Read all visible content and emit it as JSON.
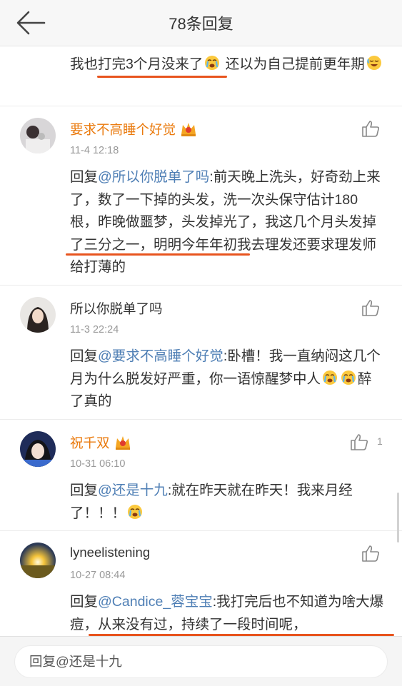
{
  "header": {
    "title": "78条回复"
  },
  "continuation": {
    "parts": [
      "我也",
      "打完3个月没来了",
      " 还以为自己提前更年期"
    ]
  },
  "comments": [
    {
      "name": "要求不高睡个好觉",
      "vip": true,
      "time": "11-4 12:18",
      "likes": "",
      "reply": {
        "prefix": "回复",
        "mention": "@所以你脱单了吗",
        "text_a": ":前天晚上洗头，好奇劲上来了，数了一下掉的头发，洗一次头保守估计180根，昨晚做噩梦，头发掉光了，我这",
        "highlight": "几个月头发掉了三分之一",
        "text_b": "，明明今年年初我去理发还要求理发师给打薄的"
      }
    },
    {
      "name": "所以你脱单了吗",
      "vip": false,
      "time": "11-3 22:24",
      "likes": "",
      "reply": {
        "prefix": "回复",
        "mention": "@要求不高睡个好觉",
        "text_a": ":卧槽！我一直纳闷这几个月为什么脱发好严重，你一语惊醒梦中人",
        "text_b": "醉了真的"
      }
    },
    {
      "name": "祝千双",
      "vip": true,
      "time": "10-31 06:10",
      "likes": "1",
      "reply": {
        "prefix": "回复",
        "mention": "@还是十九",
        "text_a": ":就在昨天就在昨天！我来月经了！！！"
      }
    },
    {
      "name": "lyneelistening",
      "vip": false,
      "time": "10-27 08:44",
      "likes": "",
      "reply": {
        "prefix": "回复",
        "mention": "@Candice_蓉宝宝",
        "text_a": ":我打完后也不知道为啥",
        "highlight": "大爆痘，从来没有过，持续了一段时间呢，",
        "text_b": ""
      }
    }
  ],
  "footer": {
    "input_placeholder": "回复@还是十九"
  },
  "colors": {
    "name_vip": "#ea7a0d",
    "mention": "#4f7fb5",
    "underline": "#e8541e",
    "time": "#999999"
  },
  "icons": [
    "back-arrow-icon",
    "thumbs-up-icon",
    "crown-badge-icon",
    "crying-emoji-icon",
    "sweat-laugh-emoji-icon"
  ]
}
